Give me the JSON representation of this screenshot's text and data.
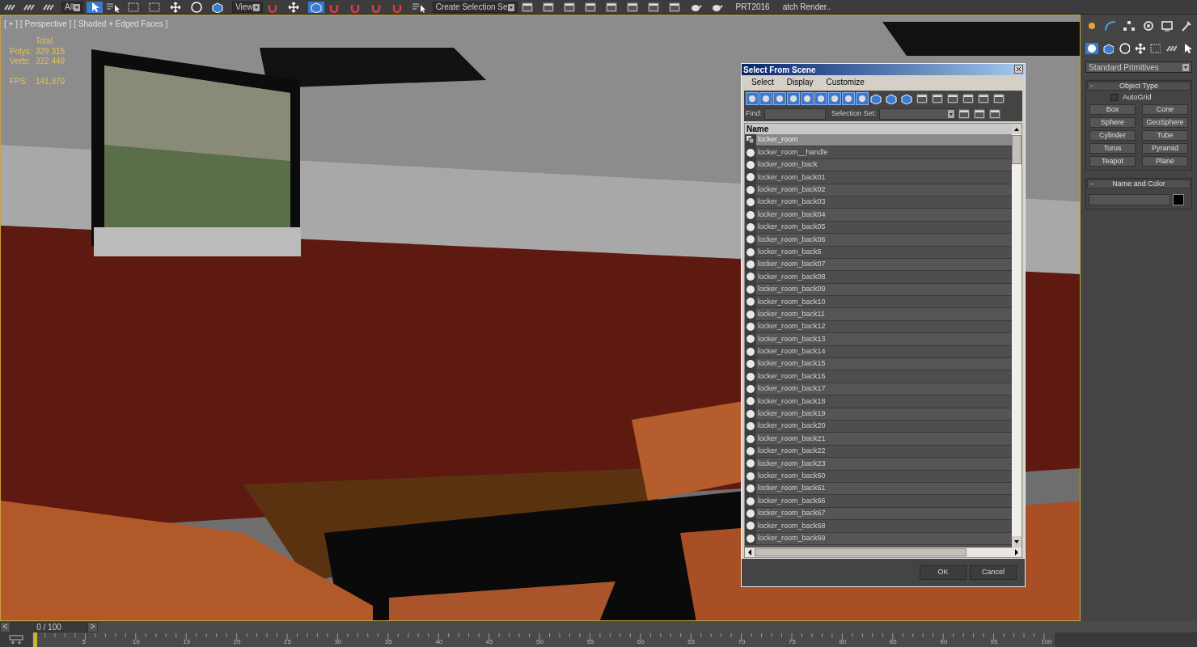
{
  "toolbar": {
    "selection_filter": "All",
    "coordinate_system": "View",
    "named_selection": "Create Selection Se",
    "buttons": [
      "PRT2016",
      "atch Render.."
    ]
  },
  "viewport": {
    "labels": [
      "[ + ]",
      "[ Perspective ]",
      "[ Shaded + Edged Faces ]"
    ],
    "stats_header": "Total",
    "stats": [
      {
        "label": "Polys:",
        "value": "329 315"
      },
      {
        "label": "Verts:",
        "value": "322 449"
      }
    ],
    "fps_label": "FPS:",
    "fps_value": "141,370"
  },
  "dialog": {
    "title": "Select From Scene",
    "menu": [
      "Select",
      "Display",
      "Customize"
    ],
    "filters": [
      {
        "on": true
      },
      {
        "on": true
      },
      {
        "on": true
      },
      {
        "on": true
      },
      {
        "on": true
      },
      {
        "on": true
      },
      {
        "on": true
      },
      {
        "on": true
      },
      {
        "on": true
      }
    ],
    "find_label": "Find:",
    "selection_set_label": "Selection Set:",
    "column": "Name",
    "rows": [
      {
        "name": "locker_room",
        "kind": "group",
        "selected": true
      },
      {
        "name": "locker_room__handle",
        "kind": "object",
        "selected": false
      },
      {
        "name": "locker_room_back",
        "kind": "object",
        "selected": false
      },
      {
        "name": "locker_room_back01",
        "kind": "object",
        "selected": false
      },
      {
        "name": "locker_room_back02",
        "kind": "object",
        "selected": false
      },
      {
        "name": "locker_room_back03",
        "kind": "object",
        "selected": false
      },
      {
        "name": "locker_room_back04",
        "kind": "object",
        "selected": false
      },
      {
        "name": "locker_room_back05",
        "kind": "object",
        "selected": false
      },
      {
        "name": "locker_room_back06",
        "kind": "object",
        "selected": false
      },
      {
        "name": "locker_room_back6",
        "kind": "object",
        "selected": false
      },
      {
        "name": "locker_room_back07",
        "kind": "object",
        "selected": false
      },
      {
        "name": "locker_room_back08",
        "kind": "object",
        "selected": false
      },
      {
        "name": "locker_room_back09",
        "kind": "object",
        "selected": false
      },
      {
        "name": "locker_room_back10",
        "kind": "object",
        "selected": false
      },
      {
        "name": "locker_room_back11",
        "kind": "object",
        "selected": false
      },
      {
        "name": "locker_room_back12",
        "kind": "object",
        "selected": false
      },
      {
        "name": "locker_room_back13",
        "kind": "object",
        "selected": false
      },
      {
        "name": "locker_room_back14",
        "kind": "object",
        "selected": false
      },
      {
        "name": "locker_room_back15",
        "kind": "object",
        "selected": false
      },
      {
        "name": "locker_room_back16",
        "kind": "object",
        "selected": false
      },
      {
        "name": "locker_room_back17",
        "kind": "object",
        "selected": false
      },
      {
        "name": "locker_room_back18",
        "kind": "object",
        "selected": false
      },
      {
        "name": "locker_room_back19",
        "kind": "object",
        "selected": false
      },
      {
        "name": "locker_room_back20",
        "kind": "object",
        "selected": false
      },
      {
        "name": "locker_room_back21",
        "kind": "object",
        "selected": false
      },
      {
        "name": "locker_room_back22",
        "kind": "object",
        "selected": false
      },
      {
        "name": "locker_room_back23",
        "kind": "object",
        "selected": false
      },
      {
        "name": "locker_room_back60",
        "kind": "object",
        "selected": false
      },
      {
        "name": "locker_room_back61",
        "kind": "object",
        "selected": false
      },
      {
        "name": "locker_room_back66",
        "kind": "object",
        "selected": false
      },
      {
        "name": "locker_room_back67",
        "kind": "object",
        "selected": false
      },
      {
        "name": "locker_room_back68",
        "kind": "object",
        "selected": false
      },
      {
        "name": "locker_room_back69",
        "kind": "object",
        "selected": false
      }
    ],
    "buttons": [
      "OK",
      "Cancel"
    ]
  },
  "command_panel": {
    "category": "Standard Primitives",
    "object_type_title": "Object Type",
    "collapse_mark": "-",
    "autogrid": {
      "label": "AutoGrid",
      "checked": false
    },
    "primitives": [
      "Box",
      "Cone",
      "Sphere",
      "GeoSphere",
      "Cylinder",
      "Tube",
      "Torus",
      "Pyramid",
      "Teapot",
      "Plane"
    ],
    "name_color_title": "Name and Color",
    "name_color": {
      "color": "#000000"
    }
  },
  "timeline": {
    "prev": "<",
    "frame": "0 / 100",
    "level": 0,
    "next": ">",
    "ticks": [
      "5",
      "10",
      "15",
      "20",
      "25",
      "30",
      "35",
      "40",
      "45",
      "50",
      "55",
      "60",
      "65",
      "70",
      "75",
      "80",
      "85",
      "90",
      "95",
      "100"
    ]
  }
}
